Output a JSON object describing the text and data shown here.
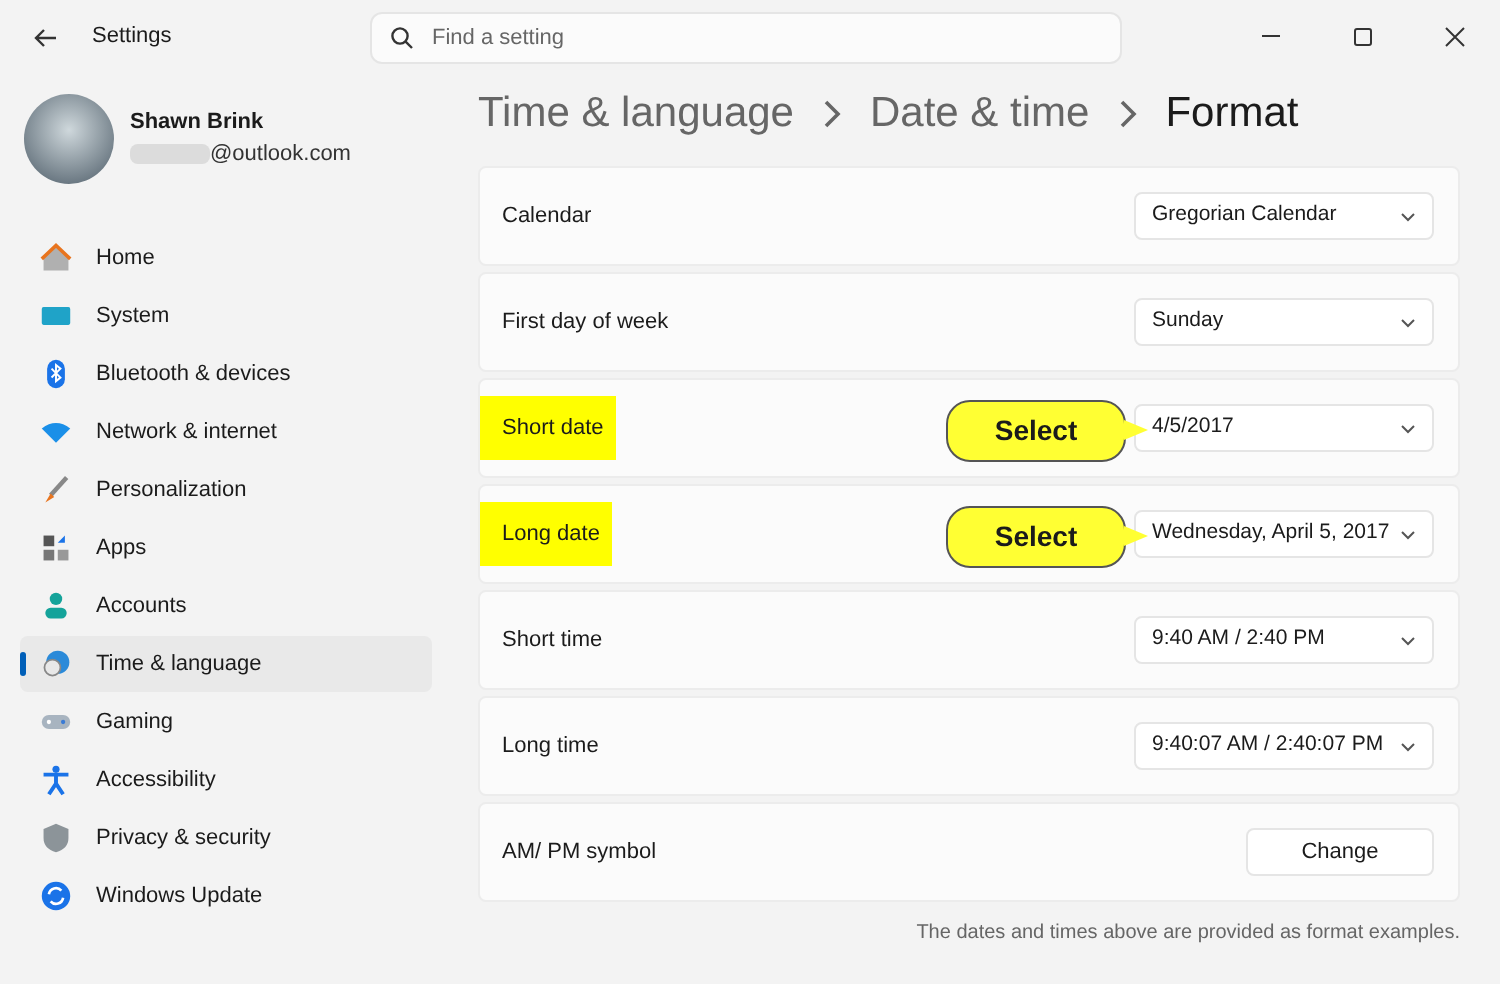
{
  "window": {
    "title": "Settings"
  },
  "search": {
    "placeholder": "Find a setting"
  },
  "account": {
    "name": "Shawn Brink",
    "email": "@outlook.com"
  },
  "sidebar": {
    "items": [
      {
        "label": "Home",
        "selected": false
      },
      {
        "label": "System",
        "selected": false
      },
      {
        "label": "Bluetooth & devices",
        "selected": false
      },
      {
        "label": "Network & internet",
        "selected": false
      },
      {
        "label": "Personalization",
        "selected": false
      },
      {
        "label": "Apps",
        "selected": false
      },
      {
        "label": "Accounts",
        "selected": false
      },
      {
        "label": "Time & language",
        "selected": true
      },
      {
        "label": "Gaming",
        "selected": false
      },
      {
        "label": "Accessibility",
        "selected": false
      },
      {
        "label": "Privacy & security",
        "selected": false
      },
      {
        "label": "Windows Update",
        "selected": false
      }
    ]
  },
  "breadcrumb": [
    "Time & language",
    "Date & time",
    "Format"
  ],
  "rows": [
    {
      "kind": "dropdown",
      "label": "Calendar",
      "value": "Gregorian Calendar",
      "highlighted": false
    },
    {
      "kind": "dropdown",
      "label": "First day of week",
      "value": "Sunday",
      "highlighted": false
    },
    {
      "kind": "dropdown",
      "label": "Short date",
      "value": "4/5/2017",
      "highlighted": true,
      "callout": "Select"
    },
    {
      "kind": "dropdown",
      "label": "Long date",
      "value": "Wednesday, April 5, 2017",
      "highlighted": true,
      "callout": "Select"
    },
    {
      "kind": "dropdown",
      "label": "Short time",
      "value": "9:40 AM / 2:40 PM",
      "highlighted": false
    },
    {
      "kind": "dropdown",
      "label": "Long time",
      "value": "9:40:07 AM / 2:40:07 PM",
      "highlighted": false
    },
    {
      "kind": "button",
      "label": "AM/ PM symbol",
      "value": "Change",
      "highlighted": false
    }
  ],
  "footnote": "The dates and times above are provided as format examples."
}
